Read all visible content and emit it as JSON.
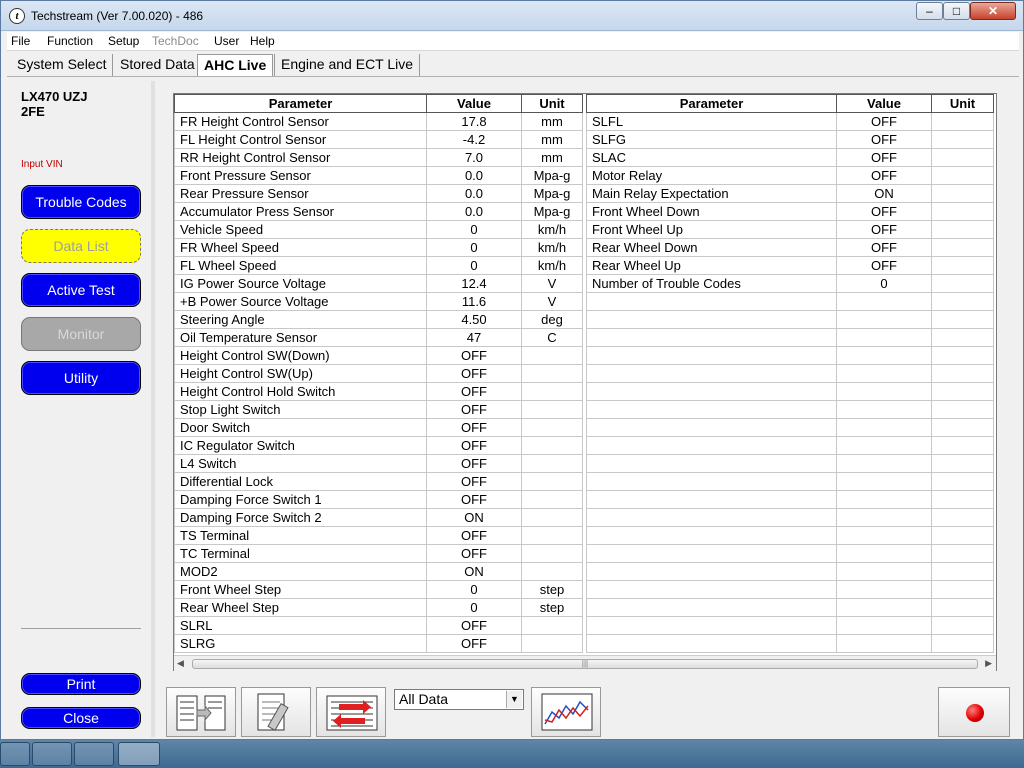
{
  "window": {
    "title": "Techstream (Ver 7.00.020) - 486",
    "min": "–",
    "max": "□",
    "close": "✕"
  },
  "menu": [
    "File",
    "Function",
    "Setup",
    "TechDoc",
    "User",
    "Help"
  ],
  "tabs": [
    "System Select",
    "Stored Data",
    "AHC Live",
    "Engine and ECT Live"
  ],
  "vehicle": {
    "model": "LX470 UZJ",
    "engine": "2FE",
    "input_vin": "Input VIN"
  },
  "left_buttons": {
    "trouble_codes": "Trouble Codes",
    "data_list": "Data List",
    "active_test": "Active Test",
    "monitor": "Monitor",
    "utility": "Utility",
    "print": "Print",
    "close": "Close"
  },
  "table": {
    "headers": {
      "parameter": "Parameter",
      "value": "Value",
      "unit": "Unit"
    },
    "left_rows": [
      [
        "FR Height Control Sensor",
        "17.8",
        "mm"
      ],
      [
        "FL Height Control Sensor",
        "-4.2",
        "mm"
      ],
      [
        "RR Height Control Sensor",
        "7.0",
        "mm"
      ],
      [
        "Front Pressure Sensor",
        "0.0",
        "Mpa-g"
      ],
      [
        "Rear Pressure Sensor",
        "0.0",
        "Mpa-g"
      ],
      [
        "Accumulator Press Sensor",
        "0.0",
        "Mpa-g"
      ],
      [
        "Vehicle Speed",
        "0",
        "km/h"
      ],
      [
        "FR Wheel Speed",
        "0",
        "km/h"
      ],
      [
        "FL Wheel Speed",
        "0",
        "km/h"
      ],
      [
        "IG Power Source Voltage",
        "12.4",
        "V"
      ],
      [
        "+B Power Source Voltage",
        "11.6",
        "V"
      ],
      [
        "Steering Angle",
        "4.50",
        "deg"
      ],
      [
        "Oil Temperature Sensor",
        "47",
        "C"
      ],
      [
        "Height Control SW(Down)",
        "OFF",
        ""
      ],
      [
        "Height Control SW(Up)",
        "OFF",
        ""
      ],
      [
        "Height Control Hold Switch",
        "OFF",
        ""
      ],
      [
        "Stop Light Switch",
        "OFF",
        ""
      ],
      [
        "Door Switch",
        "OFF",
        ""
      ],
      [
        "IC Regulator Switch",
        "OFF",
        ""
      ],
      [
        "L4 Switch",
        "OFF",
        ""
      ],
      [
        "Differential Lock",
        "OFF",
        ""
      ],
      [
        "Damping Force Switch 1",
        "OFF",
        ""
      ],
      [
        "Damping Force Switch 2",
        "ON",
        ""
      ],
      [
        "TS Terminal",
        "OFF",
        ""
      ],
      [
        "TC Terminal",
        "OFF",
        ""
      ],
      [
        "MOD2",
        "ON",
        ""
      ],
      [
        "Front Wheel Step",
        "0",
        "step"
      ],
      [
        "Rear Wheel Step",
        "0",
        "step"
      ],
      [
        "SLRL",
        "OFF",
        ""
      ],
      [
        "SLRG",
        "OFF",
        ""
      ]
    ],
    "right_rows": [
      [
        "SLFL",
        "OFF",
        ""
      ],
      [
        "SLFG",
        "OFF",
        ""
      ],
      [
        "SLAC",
        "OFF",
        ""
      ],
      [
        "Motor Relay",
        "OFF",
        ""
      ],
      [
        "Main Relay Expectation",
        "ON",
        ""
      ],
      [
        "Front Wheel Down",
        "OFF",
        ""
      ],
      [
        "Front Wheel Up",
        "OFF",
        ""
      ],
      [
        "Rear Wheel Down",
        "OFF",
        ""
      ],
      [
        "Rear Wheel Up",
        "OFF",
        ""
      ],
      [
        "Number of Trouble Codes",
        "0",
        ""
      ]
    ],
    "right_empty_rows": 20
  },
  "toolbar": {
    "data_select": "All Data"
  },
  "colors": {
    "button_blue": "#0000ee",
    "selected_yellow": "#ffff00",
    "disabled_gray": "#a8a8a8",
    "vin_red": "#c00000",
    "record_red": "#e00000"
  }
}
